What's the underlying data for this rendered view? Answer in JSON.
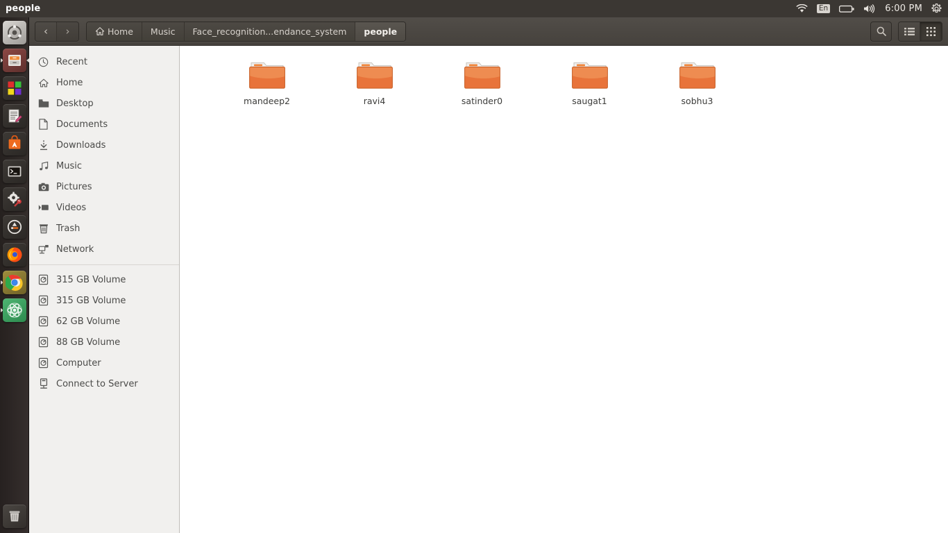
{
  "panel": {
    "title": "people",
    "tray": {
      "wifi_icon": "wifi-icon",
      "keyboard_layout": "En",
      "battery_icon": "battery-icon",
      "volume_icon": "volume-icon",
      "clock": "6:00 PM",
      "system_menu_icon": "gear-icon"
    }
  },
  "launcher": {
    "items": [
      {
        "name": "dash-home",
        "icon": "ubuntu-logo-icon",
        "running": false
      },
      {
        "name": "files",
        "icon": "file-cabinet-icon",
        "running": true
      },
      {
        "name": "software-center-tiles",
        "icon": "colored-squares-icon",
        "running": false
      },
      {
        "name": "text-editor",
        "icon": "notepad-pencil-icon",
        "running": false
      },
      {
        "name": "ubuntu-software",
        "icon": "orange-bag-icon",
        "running": false
      },
      {
        "name": "terminal",
        "icon": "terminal-icon",
        "running": false
      },
      {
        "name": "system-settings",
        "icon": "gear-wrench-icon",
        "running": false
      },
      {
        "name": "software-updater",
        "icon": "update-arrow-icon",
        "running": false
      },
      {
        "name": "firefox",
        "icon": "firefox-icon",
        "running": false
      },
      {
        "name": "google-chrome",
        "icon": "chrome-icon",
        "running": true
      },
      {
        "name": "atom-editor",
        "icon": "atom-icon",
        "running": true
      }
    ],
    "trash": {
      "name": "trash",
      "icon": "trash-icon"
    }
  },
  "toolbar": {
    "back_label": "‹",
    "forward_label": "›",
    "breadcrumbs": [
      {
        "label": "Home",
        "icon": "home-icon",
        "active": false
      },
      {
        "label": "Music",
        "icon": "",
        "active": false
      },
      {
        "label": "Face_recognition...endance_system",
        "icon": "",
        "active": false
      },
      {
        "label": "people",
        "icon": "",
        "active": true
      }
    ],
    "search_icon": "search-icon",
    "list_view_icon": "list-view-icon",
    "grid_view_icon": "grid-view-icon",
    "active_view": "grid"
  },
  "sidebar": {
    "places": [
      {
        "label": "Recent",
        "icon": "clock-icon"
      },
      {
        "label": "Home",
        "icon": "home-icon"
      },
      {
        "label": "Desktop",
        "icon": "folder-icon"
      },
      {
        "label": "Documents",
        "icon": "document-icon"
      },
      {
        "label": "Downloads",
        "icon": "download-icon"
      },
      {
        "label": "Music",
        "icon": "music-note-icon"
      },
      {
        "label": "Pictures",
        "icon": "camera-icon"
      },
      {
        "label": "Videos",
        "icon": "video-icon"
      },
      {
        "label": "Trash",
        "icon": "trash-icon"
      },
      {
        "label": "Network",
        "icon": "network-icon"
      }
    ],
    "devices": [
      {
        "label": "315 GB Volume",
        "icon": "drive-icon"
      },
      {
        "label": "315 GB Volume",
        "icon": "drive-icon"
      },
      {
        "label": "62 GB Volume",
        "icon": "drive-icon"
      },
      {
        "label": "88 GB Volume",
        "icon": "drive-icon"
      },
      {
        "label": "Computer",
        "icon": "drive-icon"
      },
      {
        "label": "Connect to Server",
        "icon": "server-icon"
      }
    ]
  },
  "content": {
    "files": [
      {
        "name": "mandeep2",
        "type": "folder"
      },
      {
        "name": "ravi4",
        "type": "folder"
      },
      {
        "name": "satinder0",
        "type": "folder"
      },
      {
        "name": "saugat1",
        "type": "folder"
      },
      {
        "name": "sobhu3",
        "type": "folder"
      }
    ]
  },
  "colors": {
    "folder_orange": "#e8733a",
    "panel_dark": "#3b3733",
    "toolbar_dark": "#4a4641",
    "sidebar_bg": "#f1f0ee",
    "content_bg": "#ffffff"
  }
}
